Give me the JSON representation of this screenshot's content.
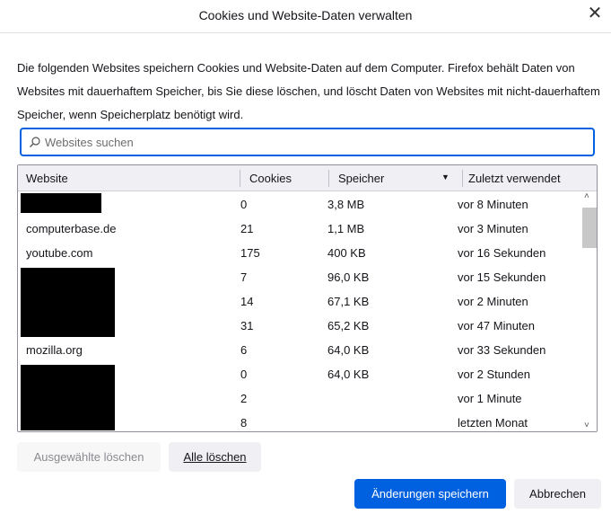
{
  "dialog": {
    "title": "Cookies und Website-Daten verwalten",
    "description": "Die folgenden Websites speichern Cookies und Website-Daten auf dem Computer. Firefox behält Daten von Websites mit dauerhaftem Speicher, bis Sie diese löschen, und löscht Daten von Websites mit nicht-dauerhaftem Speicher, wenn Speicherplatz benötigt wird."
  },
  "search": {
    "placeholder": "Websites suchen",
    "value": ""
  },
  "table": {
    "headers": [
      "Website",
      "Cookies",
      "Speicher",
      "Zuletzt verwendet"
    ],
    "sorted_by": "Speicher",
    "sort_direction": "descending",
    "rows": [
      {
        "site": "",
        "cookies": "0",
        "storage": "3,8 MB",
        "last": "vor 8 Minuten"
      },
      {
        "site": "computerbase.de",
        "cookies": "21",
        "storage": "1,1 MB",
        "last": "vor 3 Minuten"
      },
      {
        "site": "youtube.com",
        "cookies": "175",
        "storage": "400 KB",
        "last": "vor 16 Sekunden"
      },
      {
        "site": "",
        "cookies": "7",
        "storage": "96,0 KB",
        "last": "vor 15 Sekunden"
      },
      {
        "site": "",
        "cookies": "14",
        "storage": "67,1 KB",
        "last": "vor 2 Minuten"
      },
      {
        "site": "",
        "cookies": "31",
        "storage": "65,2 KB",
        "last": "vor 47 Minuten"
      },
      {
        "site": "mozilla.org",
        "cookies": "6",
        "storage": "64,0 KB",
        "last": "vor 33 Sekunden"
      },
      {
        "site": "",
        "cookies": "0",
        "storage": "64,0 KB",
        "last": "vor 2 Stunden"
      },
      {
        "site": "",
        "cookies": "2",
        "storage": "",
        "last": "vor 1 Minute"
      },
      {
        "site": "",
        "cookies": "8",
        "storage": "",
        "last": "letzten Monat"
      }
    ]
  },
  "buttons": {
    "remove_selected": "Ausgewählte löschen",
    "remove_all": "Alle löschen",
    "save": "Änderungen speichern",
    "cancel": "Abbrechen"
  },
  "colors": {
    "accent": "#0061e0"
  }
}
